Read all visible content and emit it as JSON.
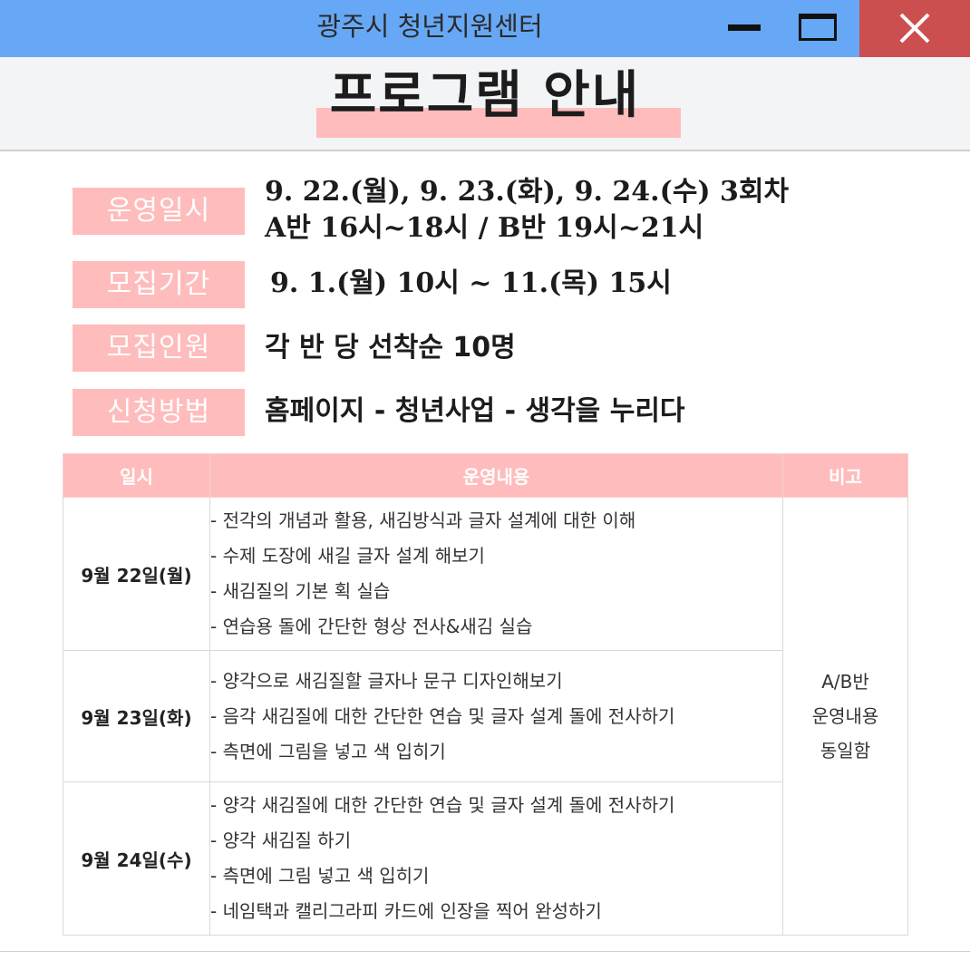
{
  "window": {
    "title": "광주시 청년지원센터",
    "controls": [
      "minimize",
      "maximize",
      "close"
    ]
  },
  "heading": "프로그램 안내",
  "info": [
    {
      "label": "운영일시",
      "lines": [
        "9. 22.(월), 9. 23.(화), 9. 24.(수) 3회차",
        "A반 16시~18시 / B반 19시~21시"
      ]
    },
    {
      "label": "모집기간",
      "lines": [
        "9. 1.(월) 10시 ~ 11.(목) 15시"
      ]
    },
    {
      "label": "모집인원",
      "lines": [
        "각 반 당 선착순 10명"
      ]
    },
    {
      "label": "신청방법",
      "lines": [
        "홈페이지 - 청년사업 - 생각을 누리다"
      ]
    }
  ],
  "table": {
    "headers": [
      "일시",
      "운영내용",
      "비고"
    ],
    "rows": [
      {
        "date": "9월 22일(월)",
        "items": [
          "- 전각의 개념과 활용, 새김방식과 글자 설계에 대한 이해",
          "- 수제 도장에 새길 글자 설계 해보기",
          "- 새김질의 기본 획 실습",
          "- 연습용 돌에 간단한 형상 전사&새김 실습"
        ]
      },
      {
        "date": "9월 23일(화)",
        "items": [
          "- 양각으로 새김질할 글자나 문구 디자인해보기",
          "- 음각 새김질에 대한 간단한 연습 및 글자 설계 돌에 전사하기",
          "- 측면에 그림을 넣고 색 입히기"
        ]
      },
      {
        "date": "9월 24일(수)",
        "items": [
          "- 양각 새김질에 대한 간단한 연습 및 글자 설계 돌에 전사하기",
          "- 양각 새김질 하기",
          "- 측면에 그림 넣고 색 입히기",
          "- 네임택과 캘리그라피 카드에 인장을 찍어 완성하기"
        ]
      }
    ],
    "note": [
      "A/B반",
      "운영내용",
      "동일함"
    ]
  },
  "colors": {
    "titlebar": "#66a8f5",
    "close_button": "#cc4f4f",
    "accent_pink": "#ffbcbc",
    "heading_band": "#f3f4f6"
  }
}
